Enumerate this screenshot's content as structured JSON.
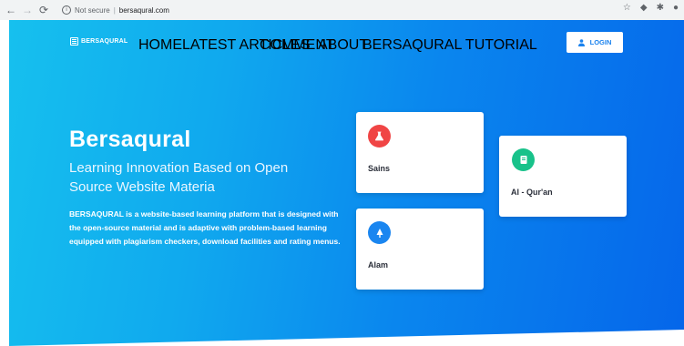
{
  "browser": {
    "status": "Not secure",
    "url": "bersaqural.com"
  },
  "brand": {
    "name": "BERSAQURAL"
  },
  "menu": [
    {
      "label": "HOME"
    },
    {
      "label": "LATEST ARTICLES"
    },
    {
      "label": "COMMENT"
    },
    {
      "label": "ABOUT"
    },
    {
      "label": "BERSAQURAL TUTORIAL"
    }
  ],
  "login": {
    "label": "LOGIN"
  },
  "hero": {
    "title": "Bersaqural",
    "subtitle": "Learning Innovation Based on Open Source Website Materia",
    "description": "BERSAQURAL is a website-based learning platform that is designed with the open-source material and is adaptive with problem-based learning equipped with plagiarism checkers, download facilities and rating menus."
  },
  "cards": [
    {
      "label": "Sains",
      "icon": "flask-icon",
      "color": "#f04545"
    },
    {
      "label": "Al - Qur'an",
      "icon": "book-icon",
      "color": "#18c28a"
    },
    {
      "label": "Alam",
      "icon": "tree-icon",
      "color": "#1a86f0"
    }
  ]
}
